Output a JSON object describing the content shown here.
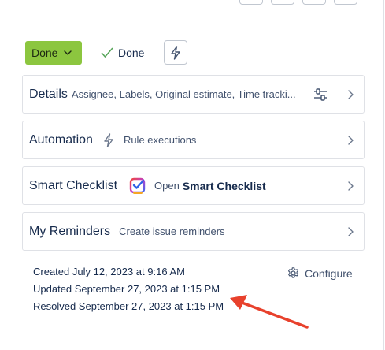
{
  "status_button": {
    "label": "Done"
  },
  "resolution": {
    "label": "Done"
  },
  "panels": {
    "details": {
      "title": "Details",
      "subtitle": "Assignee, Labels, Original estimate, Time tracki..."
    },
    "automation": {
      "title": "Automation",
      "subtitle": "Rule executions"
    },
    "smart_checklist": {
      "title": "Smart Checklist",
      "subtitle_prefix": "Open",
      "subtitle_bold": "Smart Checklist"
    },
    "reminders": {
      "title": "My Reminders",
      "subtitle": "Create issue reminders"
    }
  },
  "dates": {
    "created": "Created July 12, 2023 at 9:16 AM",
    "updated": "Updated September 27, 2023 at 1:15 PM",
    "resolved": "Resolved September 27, 2023 at 1:15 PM"
  },
  "configure": {
    "label": "Configure"
  },
  "colors": {
    "status_green": "#8cc63f",
    "check_green": "#57a55a",
    "annotation_red": "#e8412c",
    "text": "#172b4d",
    "subtext": "#42526e",
    "border": "#dfe1e6"
  },
  "icons": {
    "status_chevron": "chevron-down-icon",
    "resolution": "checkmark-icon",
    "quick_action": "lightning-bolt-icon",
    "details_config": "sliders-icon",
    "automation": "lightning-bolt-icon",
    "smart_checklist": "checklist-app-icon",
    "panel_expand": "chevron-right-icon",
    "configure": "gear-icon"
  }
}
